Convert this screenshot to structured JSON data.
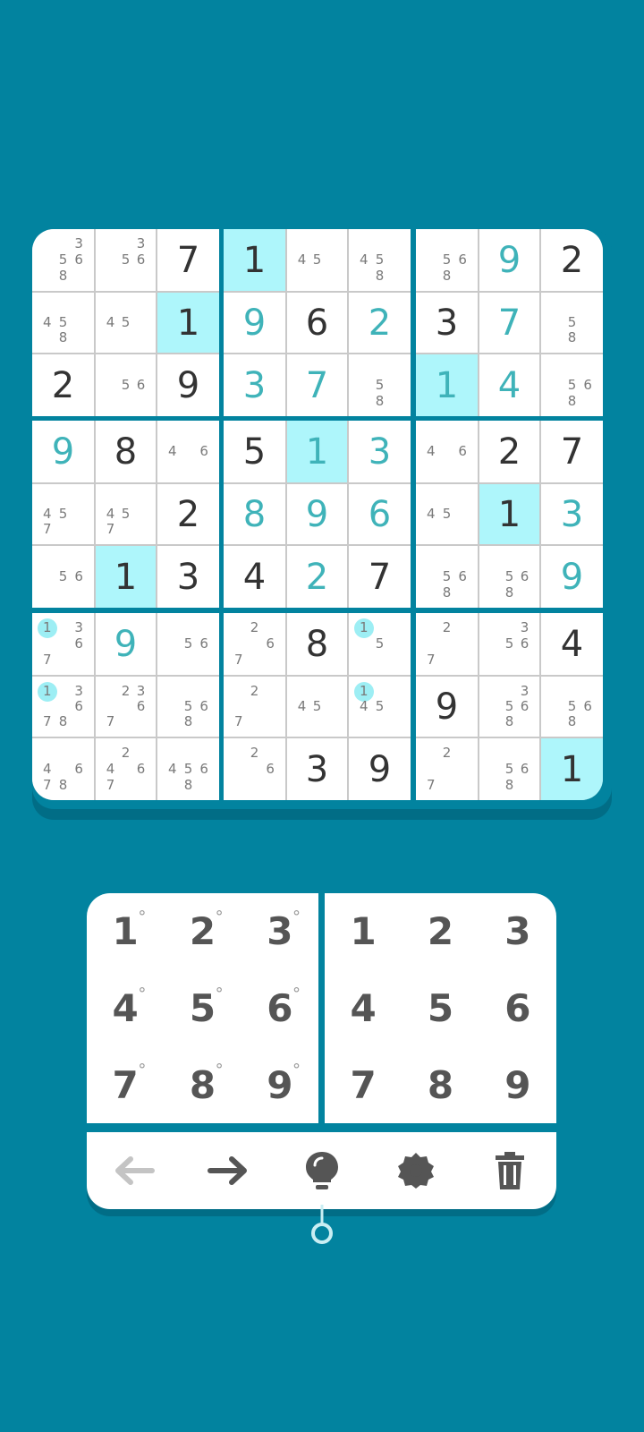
{
  "colors": {
    "background": "#02839f",
    "highlight": "#aef6fb",
    "given_digit": "#333333",
    "filled_digit": "#3fb3b9",
    "note_digit": "#7a7a7a",
    "note_marker": "#9deef4"
  },
  "board": {
    "rows": [
      [
        {
          "n": "3568"
        },
        {
          "n": "356"
        },
        {
          "v": "7",
          "t": "g"
        },
        {
          "v": "1",
          "t": "g",
          "hl": true
        },
        {
          "n": "45"
        },
        {
          "n": "458"
        },
        {
          "n": "568"
        },
        {
          "v": "9",
          "t": "f"
        },
        {
          "v": "2",
          "t": "g"
        }
      ],
      [
        {
          "n": "458"
        },
        {
          "n": "45"
        },
        {
          "v": "1",
          "t": "g",
          "hl": true
        },
        {
          "v": "9",
          "t": "f"
        },
        {
          "v": "6",
          "t": "g"
        },
        {
          "v": "2",
          "t": "f"
        },
        {
          "v": "3",
          "t": "g"
        },
        {
          "v": "7",
          "t": "f"
        },
        {
          "n": "58"
        }
      ],
      [
        {
          "v": "2",
          "t": "g"
        },
        {
          "n": "56"
        },
        {
          "v": "9",
          "t": "g"
        },
        {
          "v": "3",
          "t": "f"
        },
        {
          "v": "7",
          "t": "f"
        },
        {
          "n": "58"
        },
        {
          "v": "1",
          "t": "f",
          "hl": true
        },
        {
          "v": "4",
          "t": "f"
        },
        {
          "n": "568"
        }
      ],
      [
        {
          "v": "9",
          "t": "f"
        },
        {
          "v": "8",
          "t": "g"
        },
        {
          "n": "46"
        },
        {
          "v": "5",
          "t": "g"
        },
        {
          "v": "1",
          "t": "f",
          "hl": true
        },
        {
          "v": "3",
          "t": "f"
        },
        {
          "n": "46"
        },
        {
          "v": "2",
          "t": "g"
        },
        {
          "v": "7",
          "t": "g"
        }
      ],
      [
        {
          "n": "457"
        },
        {
          "n": "457"
        },
        {
          "v": "2",
          "t": "g"
        },
        {
          "v": "8",
          "t": "f"
        },
        {
          "v": "9",
          "t": "f"
        },
        {
          "v": "6",
          "t": "f"
        },
        {
          "n": "45"
        },
        {
          "v": "1",
          "t": "g",
          "hl": true
        },
        {
          "v": "3",
          "t": "f"
        }
      ],
      [
        {
          "n": "56"
        },
        {
          "v": "1",
          "t": "g",
          "hl": true
        },
        {
          "v": "3",
          "t": "g"
        },
        {
          "v": "4",
          "t": "g"
        },
        {
          "v": "2",
          "t": "f"
        },
        {
          "v": "7",
          "t": "g"
        },
        {
          "n": "568"
        },
        {
          "n": "568"
        },
        {
          "v": "9",
          "t": "f"
        }
      ],
      [
        {
          "n": "1367",
          "m": "1"
        },
        {
          "v": "9",
          "t": "f"
        },
        {
          "n": "56"
        },
        {
          "n": "267"
        },
        {
          "v": "8",
          "t": "g"
        },
        {
          "n": "15",
          "m": "1"
        },
        {
          "n": "27"
        },
        {
          "n": "356"
        },
        {
          "v": "4",
          "t": "g"
        }
      ],
      [
        {
          "n": "13678",
          "m": "1"
        },
        {
          "n": "2367"
        },
        {
          "n": "568"
        },
        {
          "n": "27"
        },
        {
          "n": "45"
        },
        {
          "n": "145",
          "m": "1"
        },
        {
          "v": "9",
          "t": "g"
        },
        {
          "n": "3568"
        },
        {
          "n": "568"
        }
      ],
      [
        {
          "n": "4678"
        },
        {
          "n": "2467"
        },
        {
          "n": "4568"
        },
        {
          "n": "26"
        },
        {
          "v": "3",
          "t": "g"
        },
        {
          "v": "9",
          "t": "g"
        },
        {
          "n": "27"
        },
        {
          "n": "568"
        },
        {
          "v": "1",
          "t": "g",
          "hl": true
        }
      ]
    ]
  },
  "keypad": {
    "notes_mode_keys": [
      "1",
      "2",
      "3",
      "4",
      "5",
      "6",
      "7",
      "8",
      "9"
    ],
    "notes_mark": "°",
    "value_keys": [
      "1",
      "2",
      "3",
      "4",
      "5",
      "6",
      "7",
      "8",
      "9"
    ]
  },
  "toolbar": {
    "tools": [
      {
        "name": "undo-button",
        "icon": "arrow-left-icon",
        "enabled": false
      },
      {
        "name": "redo-button",
        "icon": "arrow-right-icon",
        "enabled": true
      },
      {
        "name": "hint-button",
        "icon": "lightbulb-icon",
        "enabled": true
      },
      {
        "name": "settings-button",
        "icon": "gear-icon",
        "enabled": true
      },
      {
        "name": "delete-button",
        "icon": "trash-icon",
        "enabled": true
      }
    ]
  }
}
